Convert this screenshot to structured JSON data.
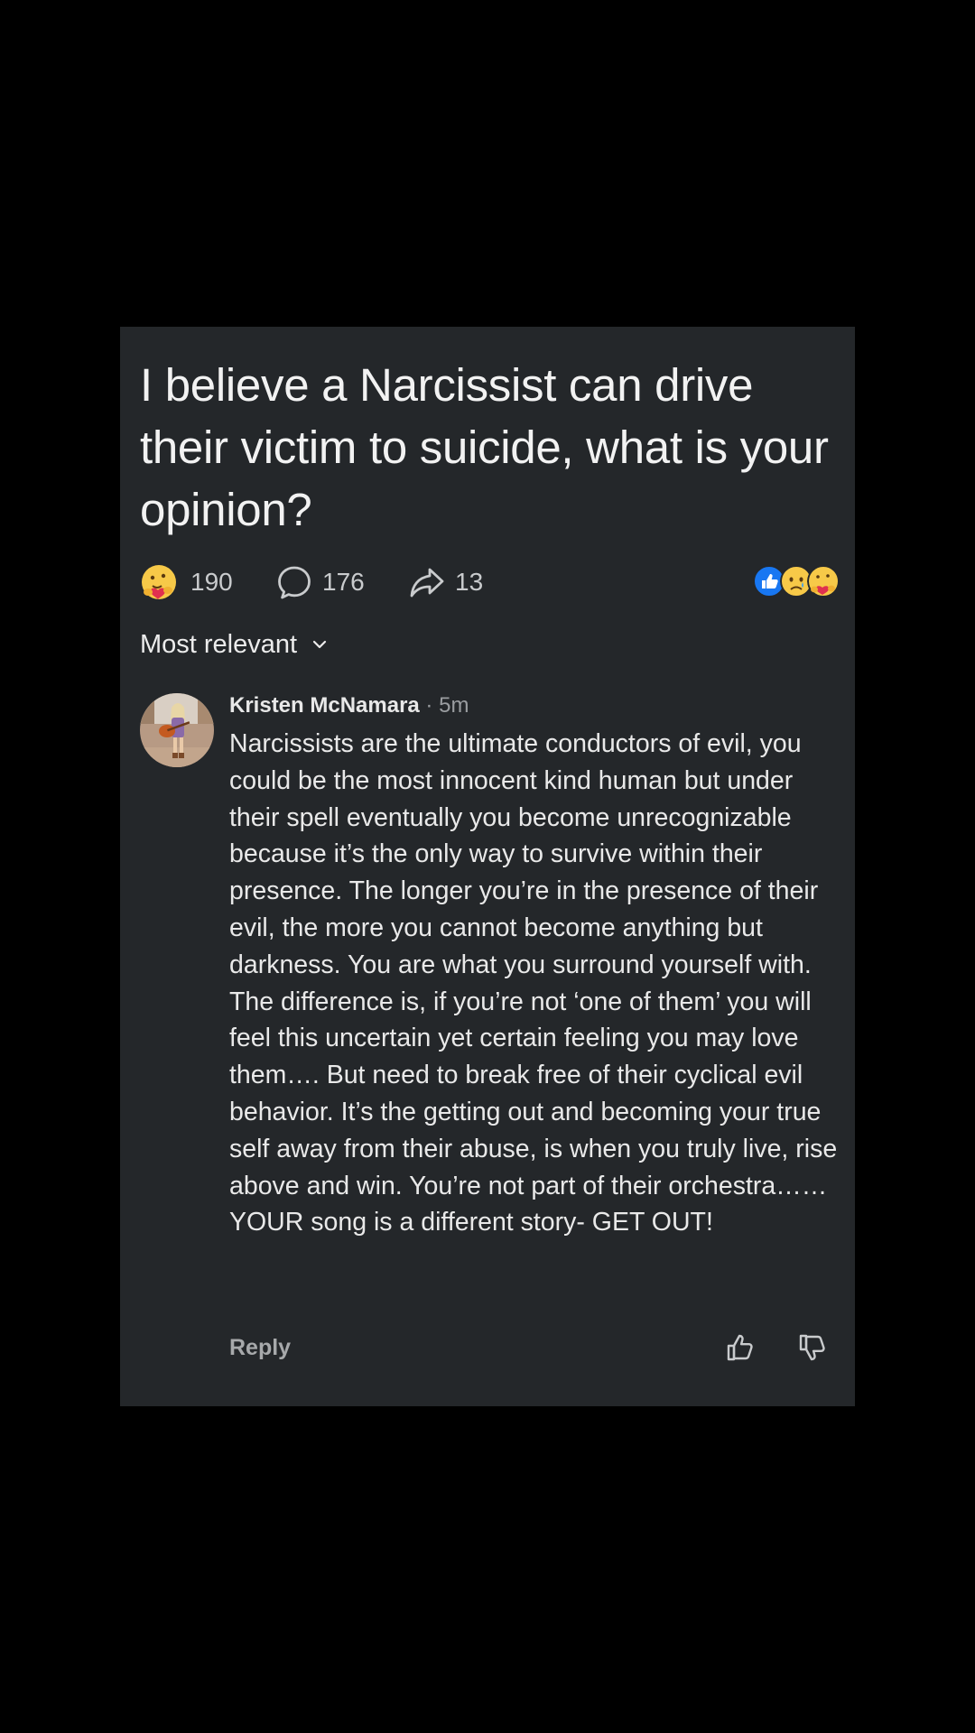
{
  "post": {
    "title": "I believe a Narcissist can drive their victim to suicide, what is your opinion?"
  },
  "stats": {
    "reactions": "190",
    "comments": "176",
    "shares": "13",
    "reaction_icons": [
      "like-icon",
      "sad-icon",
      "care-icon"
    ]
  },
  "sort": {
    "label": "Most relevant"
  },
  "comment": {
    "author": "Kristen McNamara",
    "separator": "·",
    "time": "5m",
    "text": "Narcissists are the ultimate conductors of evil, you could be the most innocent kind human but under their spell eventually you become unrecognizable because it’s the only way to survive within their presence. The longer you’re in the presence of their evil, the more you cannot become anything but darkness. You are what you surround yourself with. The difference is, if you’re not ‘one of them’ you will feel this uncertain yet certain feeling you may love them…. But need to break free of their cyclical evil behavior. It’s the getting out and becoming your true self away from their abuse, is when you truly live, rise above and win. You’re not part of their orchestra…… YOUR song is a different story- GET OUT!",
    "reply_label": "Reply"
  },
  "colors": {
    "background": "#000000",
    "card": "#24272a",
    "text": "#e9e9e9",
    "muted": "#9a9da0",
    "like_blue": "#1877f2",
    "emoji_yellow": "#f7c948"
  }
}
